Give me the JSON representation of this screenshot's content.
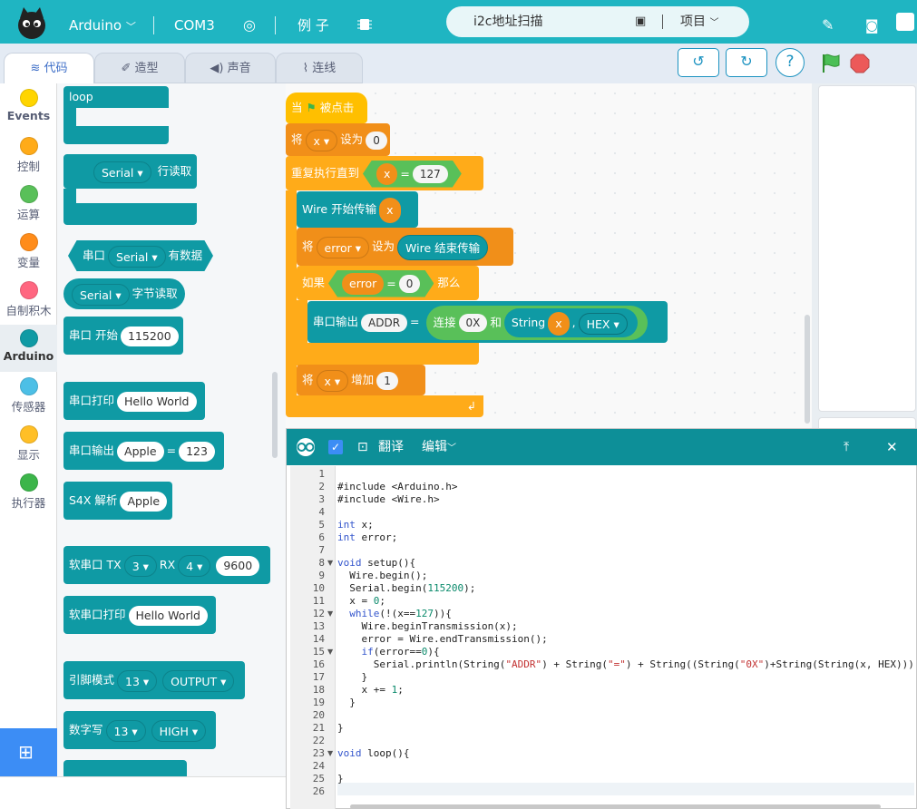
{
  "topbar": {
    "board": "Arduino",
    "port": "COM3",
    "examples": "例 子",
    "project_name": "i2c地址扫描",
    "project_menu": "项目"
  },
  "tabs": [
    "代码",
    "造型",
    "声音",
    "连线"
  ],
  "categories": [
    {
      "label": "Events",
      "color": "#ffd500"
    },
    {
      "label": "控制",
      "color": "#ffab19"
    },
    {
      "label": "运算",
      "color": "#59c059"
    },
    {
      "label": "变量",
      "color": "#ff8c1a"
    },
    {
      "label": "自制积木",
      "color": "#ff6680"
    },
    {
      "label": "Arduino",
      "color": "#0f9aa4"
    },
    {
      "label": "传感器",
      "color": "#4cbfe6"
    },
    {
      "label": "显示",
      "color": "#ffbf26"
    },
    {
      "label": "执行器",
      "color": "#3cb54a"
    }
  ],
  "palette": {
    "loop": "loop",
    "serial": "Serial",
    "line_read": "行读取",
    "serial_port": "串口",
    "has_data": "有数据",
    "byte_read": "字节读取",
    "serial_begin": "串口 开始",
    "baud": "115200",
    "serial_print": "串口打印",
    "hello": "Hello World",
    "serial_output": "串口输出",
    "apple": "Apple",
    "eq": "=",
    "n123": "123",
    "s4x": "S4X 解析",
    "soft_serial": "软串口 TX",
    "tx": "3",
    "rx_label": "RX",
    "rx": "4",
    "soft_baud": "9600",
    "soft_print": "软串口打印",
    "pin_mode": "引脚模式",
    "pin": "13",
    "output": "OUTPUT",
    "digital_write": "数字写",
    "high": "HIGH"
  },
  "script": {
    "when": "当",
    "clicked": "被点击",
    "set": "将",
    "var_x": "x",
    "set_to": "设为",
    "zero": "0",
    "repeat_until": "重复执行直到",
    "eq": "=",
    "n127": "127",
    "wire_begin": "Wire 开始传输",
    "var_error": "error",
    "wire_end": "Wire 结束传输",
    "if": "如果",
    "then": "那么",
    "serial_out": "串口输出",
    "addr": "ADDR",
    "concat": "连接",
    "ox": "0X",
    "and": "和",
    "string": "String",
    "comma": ",",
    "hex": "HEX",
    "increase": "增加",
    "one": "1"
  },
  "code_panel": {
    "translate": "翻译",
    "edit": "编辑",
    "lines": [
      "",
      "#include <Arduino.h>",
      "#include <Wire.h>",
      "",
      "int x;",
      "int error;",
      "",
      "void setup(){",
      "  Wire.begin();",
      "  Serial.begin(115200);",
      "  x = 0;",
      "  while(!(x==127)){",
      "    Wire.beginTransmission(x);",
      "    error = Wire.endTransmission();",
      "    if(error==0){",
      "      Serial.println(String(\"ADDR\") + String(\"=\") + String((String(\"0X\")+String(String(x, HEX)))",
      "    }",
      "    x += 1;",
      "  }",
      "",
      "}",
      "",
      "void loop(){",
      "",
      "}",
      ""
    ]
  }
}
